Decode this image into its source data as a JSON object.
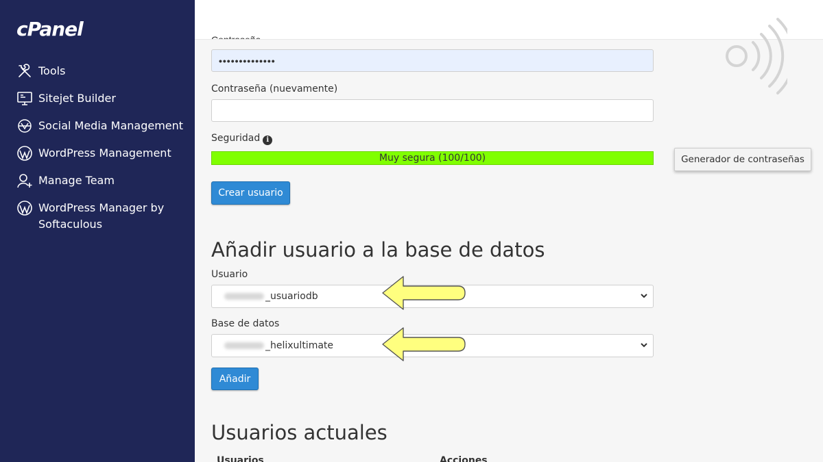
{
  "app": {
    "logo": "cPanel"
  },
  "sidebar": {
    "items": [
      {
        "label": "Tools",
        "icon": "tools-icon"
      },
      {
        "label": "Sitejet Builder",
        "icon": "monitor-icon"
      },
      {
        "label": "Social Media Management",
        "icon": "social-media-icon"
      },
      {
        "label": "WordPress Management",
        "icon": "wordpress-icon"
      },
      {
        "label": "Manage Team",
        "icon": "user-add-icon"
      },
      {
        "label": "WordPress Manager by Softaculous",
        "icon": "wordpress-icon"
      }
    ]
  },
  "form": {
    "password_label": "Contraseña",
    "password_value": "••••••••••••••",
    "password_again_label": "Contraseña (nuevamente)",
    "password_again_value": "",
    "security_label": "Seguridad",
    "strength_text": "Muy segura (100/100)",
    "strength_value": 100,
    "strength_color": "#80ff00",
    "generator_button": "Generador de contraseñas",
    "create_button": "Crear usuario"
  },
  "add_user": {
    "heading": "Añadir usuario a la base de datos",
    "user_label": "Usuario",
    "user_selected": "_usuariodb",
    "db_label": "Base de datos",
    "db_selected": "_helixultimate",
    "add_button": "Añadir"
  },
  "current_users": {
    "heading": "Usuarios actuales",
    "columns": [
      "Usuarios",
      "Acciones"
    ]
  },
  "colors": {
    "sidebar_bg": "#1f2657",
    "primary_button": "#2f8ad5",
    "arrow_fill": "#ffff7f"
  }
}
